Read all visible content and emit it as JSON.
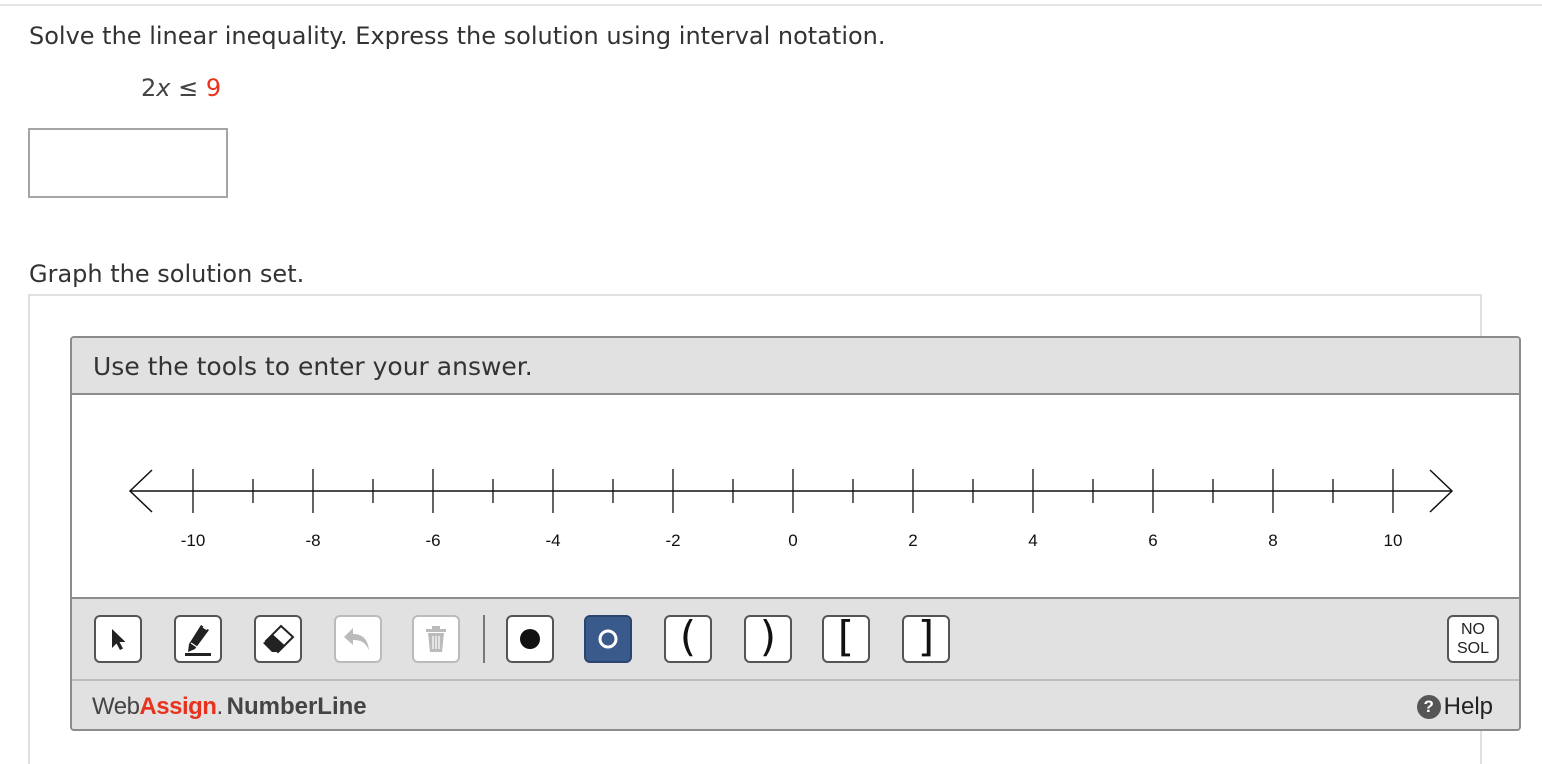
{
  "question": {
    "prompt": "Solve the linear inequality. Express the solution using interval notation.",
    "inequality_lhs_coef": "2",
    "inequality_var": "x",
    "inequality_op": " ≤ ",
    "inequality_rhs": "9",
    "answer_value": "",
    "graph_prompt": "Graph the solution set."
  },
  "widget": {
    "header": "Use the tools to enter your answer.",
    "number_line": {
      "min": -10,
      "max": 10,
      "tick_step": 1,
      "label_step": 2,
      "labels": [
        "-10",
        "-8",
        "-6",
        "-4",
        "-2",
        "0",
        "2",
        "4",
        "6",
        "8",
        "10"
      ]
    },
    "tools": [
      {
        "name": "pointer-icon"
      },
      {
        "name": "pencil-icon"
      },
      {
        "name": "eraser-icon"
      },
      {
        "name": "undo-icon"
      },
      {
        "name": "trash-icon"
      },
      {
        "name": "closed-point-icon"
      },
      {
        "name": "open-point-icon"
      },
      {
        "name": "left-paren-icon",
        "glyph": "("
      },
      {
        "name": "right-paren-icon",
        "glyph": ")"
      },
      {
        "name": "left-bracket-icon",
        "glyph": "["
      },
      {
        "name": "right-bracket-icon",
        "glyph": "]"
      }
    ],
    "no_sol_line1": "NO",
    "no_sol_line2": "SOL",
    "brand_web": "Web",
    "brand_assign": "Assign",
    "brand_dot": ".",
    "brand_product": "NumberLine",
    "help_label": "Help",
    "colors": {
      "accent": "#e8321e",
      "selected_tool": "#3b5a8c",
      "panel": "#e1e1e1"
    }
  }
}
